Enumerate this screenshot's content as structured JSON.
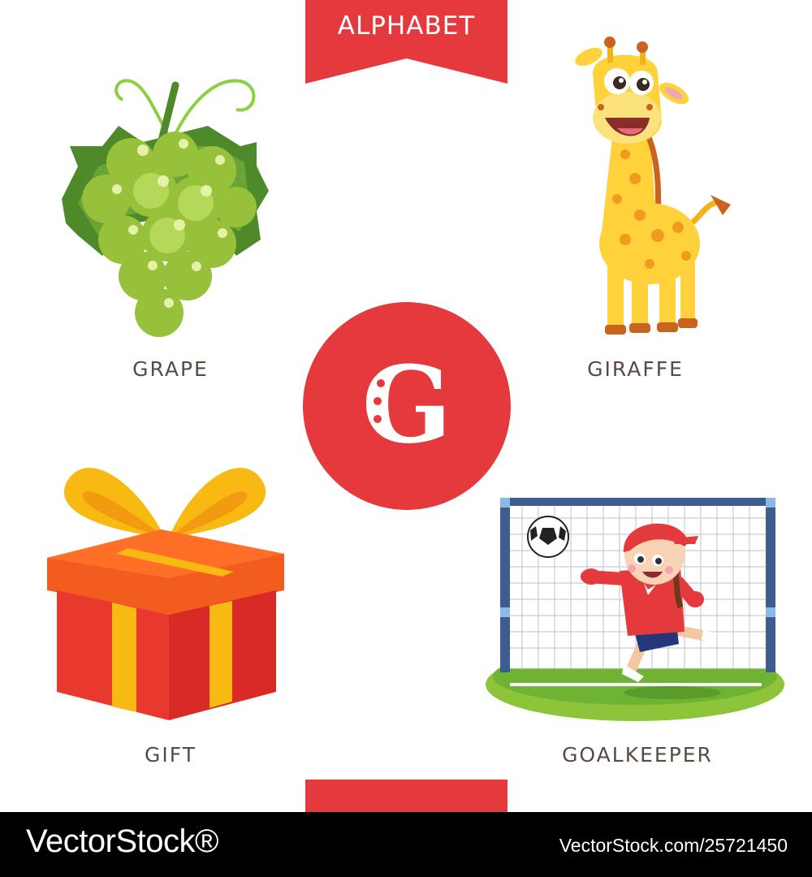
{
  "banner": {
    "title": "ALPHABET"
  },
  "letter": {
    "char": "G"
  },
  "items": [
    {
      "label": "GRAPE"
    },
    {
      "label": "GIRAFFE"
    },
    {
      "label": "GIFT"
    },
    {
      "label": "GOALKEEPER"
    }
  ],
  "footer": {
    "brand": "VectorStock®",
    "image_id": "VectorStock.com/25721450"
  },
  "colors": {
    "accent": "#e53a3d",
    "label_text": "#5a4a44",
    "footer_bg": "#000000"
  }
}
